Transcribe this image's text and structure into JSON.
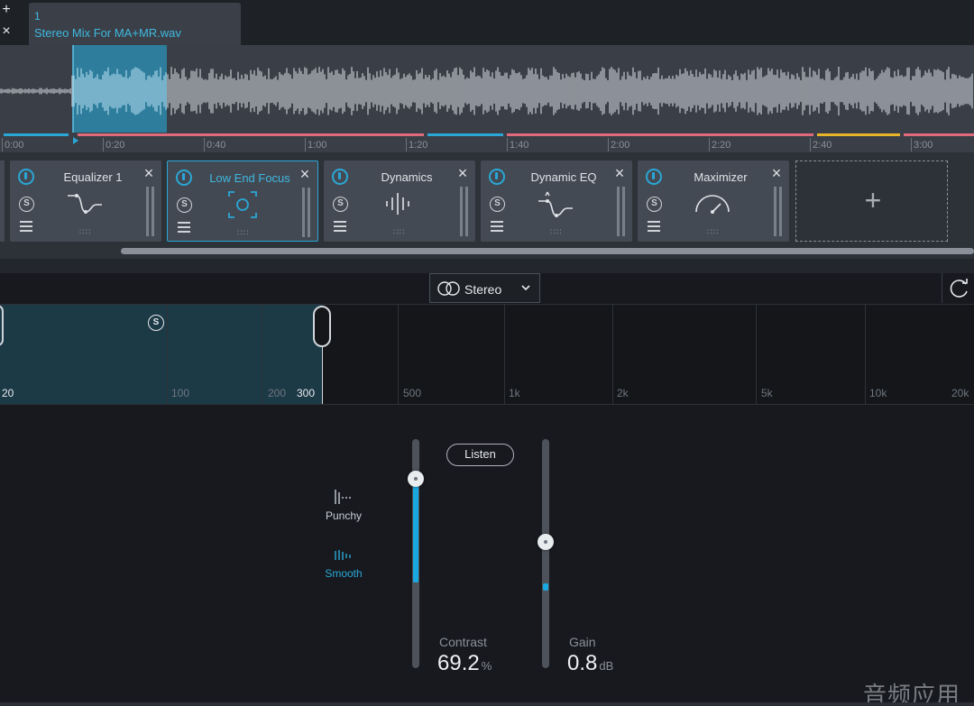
{
  "window": {
    "add_icon": "+",
    "close_icon": "×"
  },
  "file_tab": {
    "number": "1",
    "name": "Stereo Mix For MA+MR.wav"
  },
  "timeline": {
    "ticks": [
      "0:00",
      "0:20",
      "0:40",
      "1:00",
      "1:20",
      "1:40",
      "2:00",
      "2:20",
      "2:40",
      "3:00"
    ],
    "region_colors": [
      "#2aa7d6",
      "#e06a7a",
      "#2aa7d6",
      "#e06a7a",
      "#e8b52a",
      "#e06a7a"
    ]
  },
  "modules": [
    {
      "title": "Equalizer 1",
      "icon": "eq-curve-icon",
      "solo": "S",
      "selected": false
    },
    {
      "title": "Low End Focus",
      "icon": "focus-target-icon",
      "solo": "S",
      "selected": true
    },
    {
      "title": "Dynamics",
      "icon": "dynamics-bars-icon",
      "solo": "S",
      "selected": false
    },
    {
      "title": "Dynamic EQ",
      "icon": "dynamic-eq-curve-icon",
      "solo": "S",
      "selected": false
    },
    {
      "title": "Maximizer",
      "icon": "gauge-icon",
      "solo": "S",
      "selected": false
    }
  ],
  "add_module": {
    "icon": "+"
  },
  "toolbar": {
    "channel_mode": "Stereo",
    "chevron": "⌄"
  },
  "spectrum": {
    "band_solo": "S",
    "freq_labels": [
      "20",
      "100",
      "200",
      "300",
      "500",
      "1k",
      "2k",
      "5k",
      "10k",
      "20k"
    ]
  },
  "modes": [
    {
      "label": "Punchy",
      "active": false,
      "icon": "punchy-icon"
    },
    {
      "label": "Smooth",
      "active": true,
      "icon": "smooth-icon"
    }
  ],
  "listen_button": "Listen",
  "contrast": {
    "label": "Contrast",
    "value": "69.2",
    "unit": "%",
    "level": 0.69
  },
  "gain": {
    "label": "Gain",
    "value": "0.8",
    "unit": "dB"
  },
  "watermark": "音频应用",
  "colors": {
    "accent": "#2aa7d6",
    "panel": "#444a53",
    "background": "#17191e"
  }
}
